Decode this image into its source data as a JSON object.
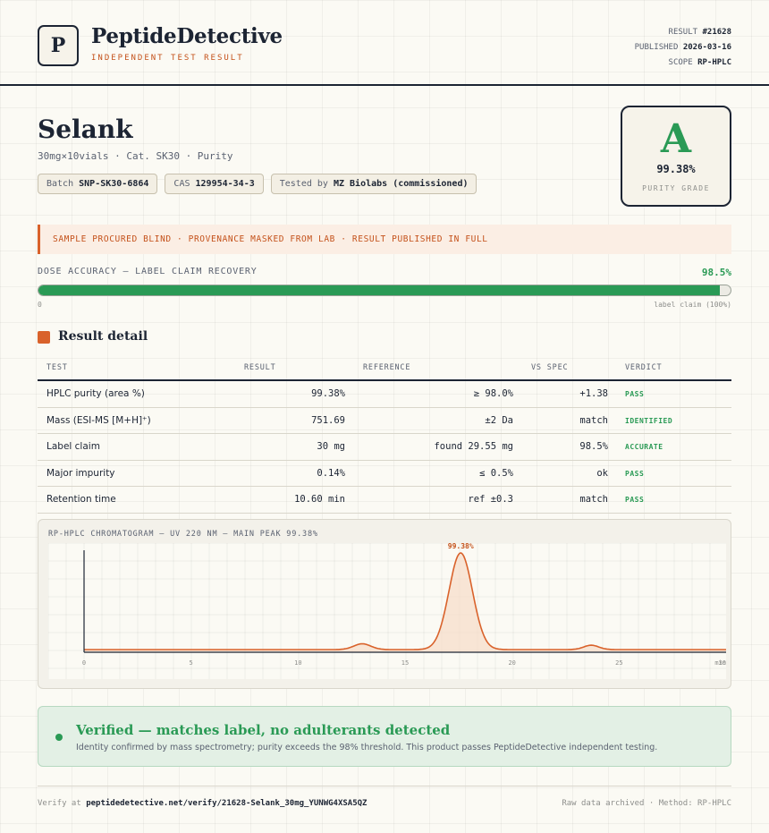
{
  "brand": {
    "logo_letter": "P",
    "name": "PeptideDetective",
    "tagline": "INDEPENDENT TEST RESULT"
  },
  "meta": {
    "result_label": "RESULT",
    "result_value": "#21628",
    "published_label": "PUBLISHED",
    "published_value": "2026-03-16",
    "scope_label": "SCOPE",
    "scope_value": "RP-HPLC"
  },
  "product": {
    "name": "Selank",
    "subtitle": "30mg×10vials · Cat. SK30 · Purity",
    "batch_label": "Batch",
    "batch_value": "SNP-SK30-6864",
    "cas_label": "CAS",
    "cas_value": "129954-34-3",
    "tested_label": "Tested by",
    "tested_value": "MZ Biolabs (commissioned)"
  },
  "grade": {
    "letter": "A",
    "value": "99.38%",
    "label": "PURITY GRADE"
  },
  "notice": "SAMPLE PROCURED BLIND · PROVENANCE MASKED FROM LAB · RESULT PUBLISHED IN FULL",
  "dose": {
    "label": "DOSE ACCURACY — LABEL CLAIM RECOVERY",
    "value": "98.5%",
    "fraction": 0.985,
    "min_label": "0",
    "max_label": "label claim (100%)"
  },
  "section_title": "Result detail",
  "table": {
    "headers": [
      "TEST",
      "RESULT",
      "REFERENCE",
      "VS SPEC",
      "VERDICT"
    ],
    "rows": [
      {
        "test": "HPLC purity (area %)",
        "result": "99.38%",
        "reference": "≥ 98.0%",
        "spec": "+1.38",
        "verdict": "PASS"
      },
      {
        "test": "Mass (ESI-MS [M+H]⁺)",
        "result": "751.69",
        "reference": "±2 Da",
        "spec": "match",
        "verdict": "IDENTIFIED"
      },
      {
        "test": "Label claim",
        "result": "30 mg",
        "reference": "found 29.55 mg",
        "spec": "98.5%",
        "verdict": "ACCURATE"
      },
      {
        "test": "Major impurity",
        "result": "0.14%",
        "reference": "≤ 0.5%",
        "spec": "ok",
        "verdict": "PASS"
      },
      {
        "test": "Retention time",
        "result": "10.60 min",
        "reference": "ref ±0.3",
        "spec": "match",
        "verdict": "PASS"
      }
    ]
  },
  "chart_data": {
    "type": "line",
    "title": "RP-HPLC CHROMATOGRAM — UV 220 NM — MAIN PEAK 99.38%",
    "xlabel": "min",
    "ylabel": "",
    "xlim": [
      0,
      30
    ],
    "ylim": [
      0,
      1
    ],
    "x_ticks": [
      0,
      5,
      10,
      15,
      20,
      25,
      30
    ],
    "x_tick_labels": [
      "0",
      "5",
      "10",
      "15",
      "20",
      "25",
      "30"
    ],
    "series": [
      {
        "peaks": [
          {
            "x": 13.0,
            "height": 0.06,
            "width": 0.4
          },
          {
            "x": 17.6,
            "height": 1.0,
            "width": 0.55,
            "label": "99.38%"
          },
          {
            "x": 23.7,
            "height": 0.045,
            "width": 0.35
          }
        ],
        "baseline": 0.0
      }
    ],
    "colors": {
      "line": "#d9622b",
      "fill": "#f7dcc7",
      "label": "#c4511a"
    },
    "grid": true
  },
  "verified": {
    "title": "Verified — matches label, no adulterants detected",
    "subtitle": "Identity confirmed by mass spectrometry; purity exceeds the 98% threshold. This product passes PeptideDetective independent testing."
  },
  "footer": {
    "verify_prefix": "Verify at",
    "verify_url": "peptidedetective.net/verify/21628-Selank_30mg_YUNWG4XSA5QZ",
    "right": "Raw data archived · Method: RP-HPLC"
  }
}
